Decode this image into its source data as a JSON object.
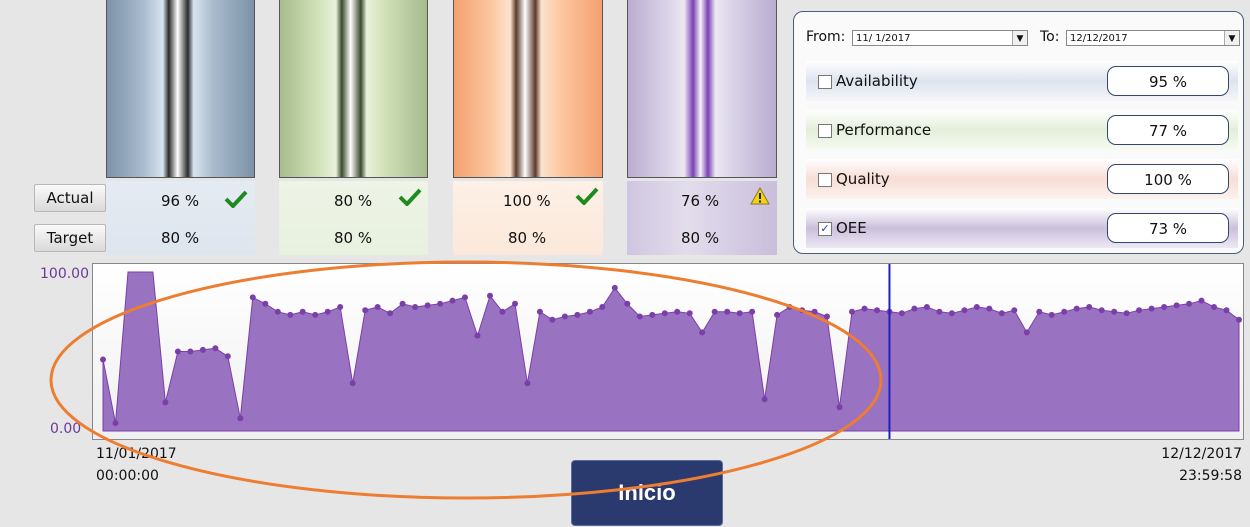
{
  "rows": {
    "actual_label": "Actual",
    "target_label": "Target"
  },
  "gauges": [
    {
      "name": "Availability",
      "actual": "96 %",
      "target": "80 %",
      "status": "check-icon"
    },
    {
      "name": "Performance",
      "actual": "80 %",
      "target": "80 %",
      "status": "check-icon"
    },
    {
      "name": "Quality",
      "actual": "100 %",
      "target": "80 %",
      "status": "check-icon"
    },
    {
      "name": "OEE",
      "actual": "76 %",
      "target": "80 %",
      "status": "warning-icon"
    }
  ],
  "filters": {
    "from_label": "From:",
    "from_value": "11/ 1/2017",
    "to_label": "To:",
    "to_value": "12/12/2017",
    "metrics": [
      {
        "label": "Availability",
        "value": "95 %",
        "checked": false
      },
      {
        "label": "Performance",
        "value": "77 %",
        "checked": false
      },
      {
        "label": "Quality",
        "value": "100 %",
        "checked": false
      },
      {
        "label": "OEE",
        "value": "73 %",
        "checked": true
      }
    ]
  },
  "chart": {
    "y_max_label": "100.00",
    "y_min_label": "0.00",
    "x_start_date": "11/01/2017",
    "x_start_time": "00:00:00",
    "x_end_date": "12/12/2017",
    "x_end_time": "23:59:58"
  },
  "chart_data": {
    "type": "area",
    "ylim": [
      0,
      100
    ],
    "series": [
      {
        "values": [
          45,
          5,
          100,
          100,
          100,
          18,
          50,
          50,
          51,
          52,
          47,
          8,
          84,
          80,
          75,
          73,
          75,
          73,
          75,
          78,
          30,
          76,
          78,
          74,
          80,
          78,
          79,
          80,
          82,
          84,
          60,
          85,
          75,
          80,
          30,
          75,
          70,
          72,
          73,
          75,
          78,
          90,
          80,
          72,
          73,
          74,
          75,
          74,
          62,
          75,
          75,
          74,
          75,
          20,
          73,
          78,
          76,
          75,
          72,
          15,
          75,
          77,
          76,
          75,
          74,
          77,
          78,
          75,
          74,
          76,
          78,
          77,
          74,
          76,
          62,
          75,
          73,
          75,
          77,
          78,
          76,
          75,
          74,
          76,
          77,
          78,
          79,
          80,
          82,
          78,
          76,
          70
        ]
      }
    ]
  },
  "start_button": "Inicio",
  "colors": {
    "series": "#9a72c2",
    "series_line": "#7b3fa8",
    "accent_panel": "#324866",
    "button": "#2a3a6e",
    "annotation": "#ed7d31"
  }
}
